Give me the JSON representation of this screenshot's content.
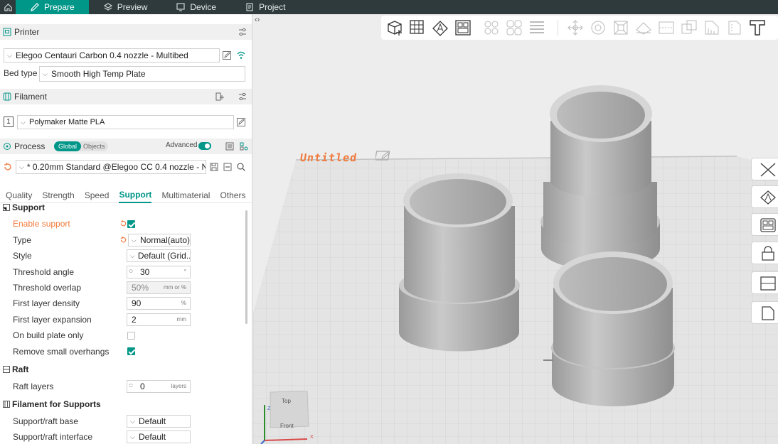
{
  "topbar": {
    "tabs": [
      {
        "label": "Prepare",
        "active": true
      },
      {
        "label": "Preview",
        "active": false
      },
      {
        "label": "Device",
        "active": false
      },
      {
        "label": "Project",
        "active": false
      }
    ]
  },
  "printer": {
    "section_label": "Printer",
    "printer_name": "Elegoo Centauri Carbon 0.4 nozzle - Multibed",
    "bed_type_label": "Bed type",
    "bed_type_value": "Smooth High Temp Plate"
  },
  "filament": {
    "section_label": "Filament",
    "slot_number": "1",
    "filament_name": "Polymaker Matte PLA"
  },
  "process": {
    "section_label": "Process",
    "toggle_global": "Global",
    "toggle_objects": "Objects",
    "advanced_label": "Advanced",
    "preset_name": "* 0.20mm Standard @Elegoo CC 0.4 nozzle - N..."
  },
  "tabs": [
    {
      "label": "Quality",
      "active": false
    },
    {
      "label": "Strength",
      "active": false
    },
    {
      "label": "Speed",
      "active": false
    },
    {
      "label": "Support",
      "active": true
    },
    {
      "label": "Multimaterial",
      "active": false
    },
    {
      "label": "Others",
      "active": false
    }
  ],
  "support": {
    "group_label": "Support",
    "enable_support": {
      "label": "Enable support",
      "checked": true
    },
    "type": {
      "label": "Type",
      "value": "Normal(auto)"
    },
    "style": {
      "label": "Style",
      "value": "Default (Grid..."
    },
    "threshold_angle": {
      "label": "Threshold angle",
      "value": "30",
      "unit": "°"
    },
    "threshold_overlap": {
      "label": "Threshold overlap",
      "value": "50%",
      "unit": "mm or %"
    },
    "first_layer_density": {
      "label": "First layer density",
      "value": "90",
      "unit": "%"
    },
    "first_layer_expansion": {
      "label": "First layer expansion",
      "value": "2",
      "unit": "mm"
    },
    "on_build_plate_only": {
      "label": "On build plate only",
      "checked": false
    },
    "remove_small_overhangs": {
      "label": "Remove small overhangs",
      "checked": true
    }
  },
  "raft": {
    "group_label": "Raft",
    "raft_layers": {
      "label": "Raft layers",
      "value": "0",
      "unit": "layers"
    }
  },
  "filament_supports": {
    "group_label": "Filament for Supports",
    "base": {
      "label": "Support/raft base",
      "value": "Default"
    },
    "interface": {
      "label": "Support/raft interface",
      "value": "Default"
    }
  },
  "viewport": {
    "plate_name": "Untitled",
    "axis_top_label": "Top",
    "axis_front_label": "Front",
    "axis_x": "X",
    "axis_z": "Z"
  },
  "colors": {
    "accent": "#009688",
    "warning": "#f07a3c",
    "topbar": "#2f3a3c"
  }
}
